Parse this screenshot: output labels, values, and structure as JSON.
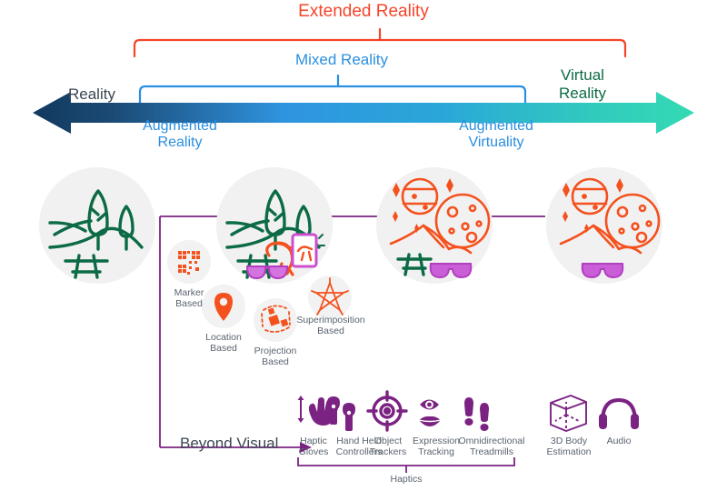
{
  "diagram": {
    "title_top": "Extended Reality",
    "spectrum": {
      "left_end_label": "Reality",
      "right_end_label": "Virtual\nReality",
      "mid_bracket_label": "Mixed Reality",
      "left_sub_label": "Augmented\nReality",
      "right_sub_label": "Augmented\nVirtuality"
    },
    "colors": {
      "extended_reality": "#f4452a",
      "mixed_reality": "#2a8fe0",
      "virtual_reality": "#0c6b45",
      "reality_text": "#3b4652",
      "arrow_left": "#12395e",
      "arrow_mid": "#2f94e0",
      "arrow_right": "#34dab3",
      "purple": "#7b2382",
      "orange_icon": "#f4511e",
      "green_scene": "#0c6b45",
      "magenta": "#cc4fd0",
      "circle_bg": "#f1f1f1",
      "small_circle_bg": "#f2f2f2",
      "label_gray": "#5a6470"
    },
    "scenes": [
      {
        "name": "reality-scene",
        "caption": ""
      },
      {
        "name": "augmented-reality-scene",
        "caption": ""
      },
      {
        "name": "augmented-virtuality-scene",
        "caption": ""
      },
      {
        "name": "virtual-reality-scene",
        "caption": ""
      }
    ],
    "ar_types": [
      {
        "label": "Marker\nBased",
        "icon": "qr-code-icon"
      },
      {
        "label": "Location\nBased",
        "icon": "map-pin-icon"
      },
      {
        "label": "Projection\nBased",
        "icon": "projection-dots-icon"
      },
      {
        "label": "Superimposition\nBased",
        "icon": "star-overlay-icon"
      }
    ],
    "beyond_visual": {
      "label": "Beyond Visual",
      "group_label": "Haptics",
      "items": [
        {
          "label": "Haptic\nGloves",
          "icon": "haptic-glove-icon"
        },
        {
          "label": "Hand Held\nControllers",
          "icon": "hand-controller-icon"
        },
        {
          "label": "Object\nTrackers",
          "icon": "crosshair-icon"
        },
        {
          "label": "Expression\nTracking",
          "icon": "eye-lips-icon"
        },
        {
          "label": "Omnidirectional\nTreadmills",
          "icon": "footprints-icon"
        },
        {
          "label": "3D Body\nEstimation",
          "icon": "cube-icon"
        },
        {
          "label": "Audio",
          "icon": "headphones-icon"
        }
      ]
    }
  }
}
